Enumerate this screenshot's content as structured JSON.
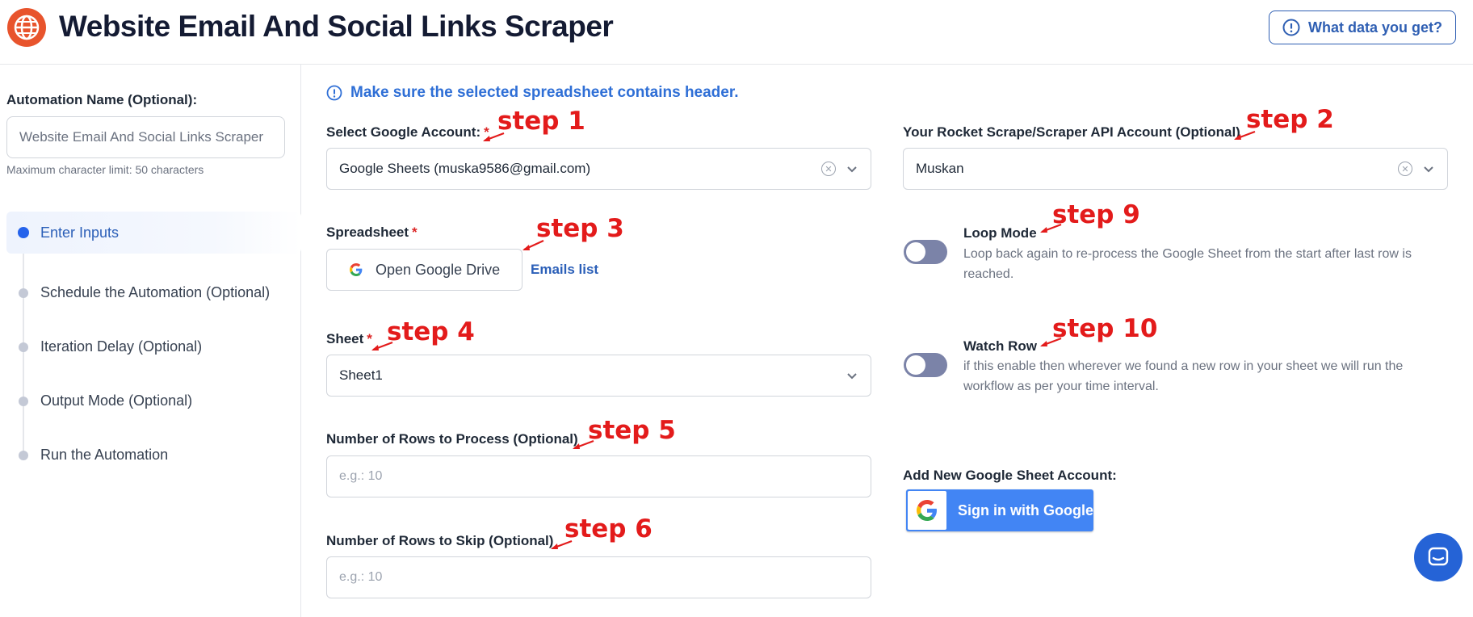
{
  "header": {
    "title": "Website Email And Social Links Scraper",
    "info_button": "What data you get?"
  },
  "sidebar": {
    "automation_name_label": "Automation Name (Optional):",
    "automation_name_placeholder": "Website Email And Social Links Scraper",
    "hint": "Maximum character limit: 50 characters",
    "steps": [
      {
        "label": "Enter Inputs",
        "active": true
      },
      {
        "label": "Schedule the Automation (Optional)",
        "active": false
      },
      {
        "label": "Iteration Delay (Optional)",
        "active": false
      },
      {
        "label": "Output Mode (Optional)",
        "active": false
      },
      {
        "label": "Run the Automation",
        "active": false
      }
    ]
  },
  "main": {
    "notice": "Make sure the selected spreadsheet contains header.",
    "google_account": {
      "label": "Select Google Account:",
      "value": "Google Sheets (muska9586@gmail.com)"
    },
    "api_account": {
      "label": "Your Rocket Scrape/Scraper API Account (Optional)",
      "value": "Muskan"
    },
    "spreadsheet": {
      "label": "Spreadsheet",
      "button": "Open Google Drive",
      "link": "Emails list"
    },
    "sheet": {
      "label": "Sheet",
      "value": "Sheet1"
    },
    "rows_to_process": {
      "label": "Number of Rows to Process (Optional)",
      "placeholder": "e.g.: 10"
    },
    "rows_to_skip": {
      "label": "Number of Rows to Skip (Optional)",
      "placeholder": "e.g.: 10"
    },
    "loop_mode": {
      "title": "Loop Mode",
      "description": "Loop back again to re-process the Google Sheet from the start after last row is reached.",
      "enabled": false
    },
    "watch_row": {
      "title": "Watch Row",
      "description": "if this enable then wherever we found a new row in your sheet we will run the workflow as per your time interval.",
      "enabled": false
    },
    "add_account": {
      "label": "Add New Google Sheet Account:",
      "button": "Sign in with Google"
    }
  },
  "annotations": {
    "step1": "step 1",
    "step2": "step 2",
    "step3": "step 3",
    "step4": "step 4",
    "step5": "step 5",
    "step6": "step 6",
    "step9": "step 9",
    "step10": "step 10"
  },
  "colors": {
    "accent": "#2f5fb3",
    "logo": "#e8542d",
    "annotation": "#e31b1b",
    "toggle_off": "#7b83a8",
    "google_blue": "#4285f4"
  }
}
